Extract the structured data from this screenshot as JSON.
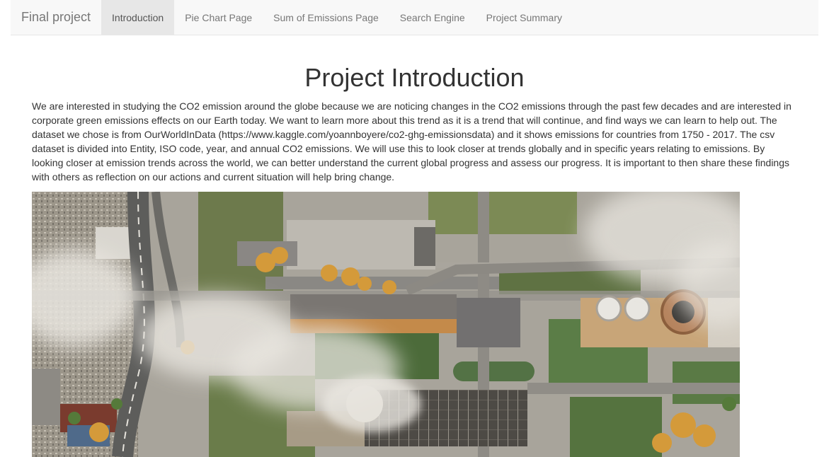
{
  "nav": {
    "brand": "Final project",
    "items": [
      {
        "label": "Introduction",
        "active": true
      },
      {
        "label": "Pie Chart Page",
        "active": false
      },
      {
        "label": "Sum of Emissions Page",
        "active": false
      },
      {
        "label": "Search Engine",
        "active": false
      },
      {
        "label": "Project Summary",
        "active": false
      }
    ]
  },
  "main": {
    "title": "Project Introduction",
    "paragraph": "We are interested in studying the CO2 emission around the globe because we are noticing changes in the CO2 emissions through the past few decades and are interested in corporate green emissions effects on our Earth today. We want to learn more about this trend as it is a trend that will continue, and find ways we can learn to help out. The dataset we chose is from OurWorldInData (https://www.kaggle.com/yoannboyere/co2-ghg-emissionsdata) and it shows emissions for countries from 1750 - 2017. The csv dataset is divided into Entity, ISO code, year, and annual CO2 emissions. We will use this to look closer at trends globally and in specific years relating to emissions. By looking closer at emission trends across the world, we can better understand the current global progress and assess our progress. It is important to then share these findings with others as reflection on our actions and current situation will help bring change."
  },
  "colors": {
    "navbar_bg": "#f8f8f8",
    "nav_active_bg": "#e7e7e7",
    "nav_text": "#777777",
    "body_text": "#333333"
  }
}
